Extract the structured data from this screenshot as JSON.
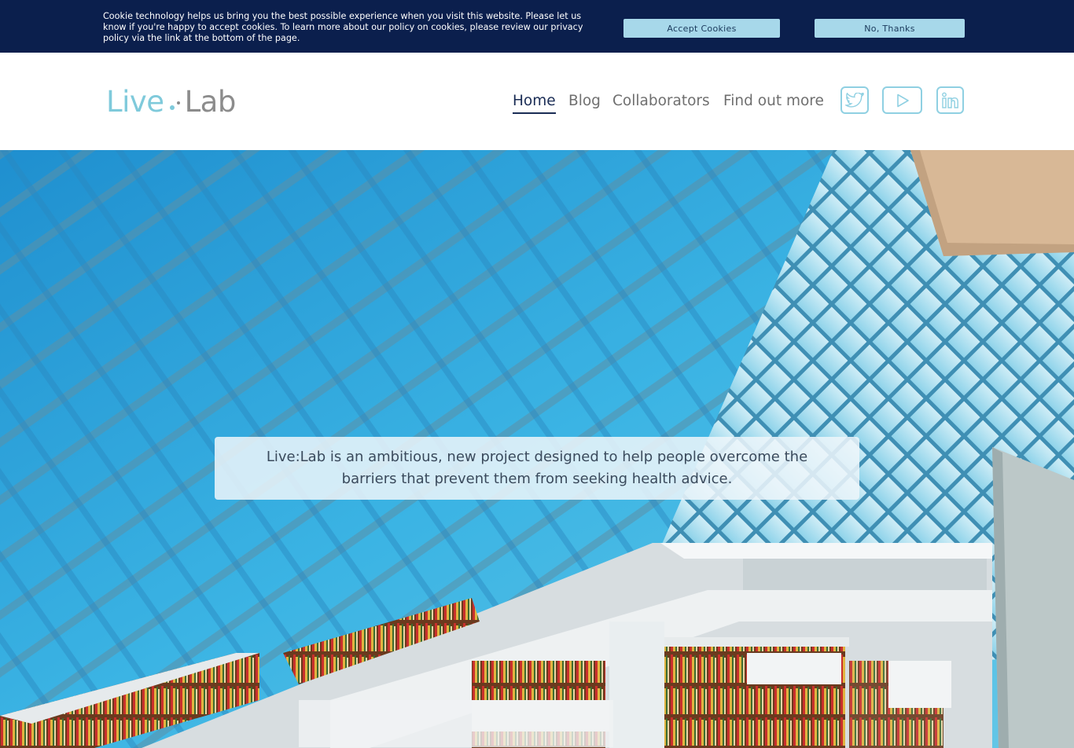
{
  "cookie_banner": {
    "message": "Cookie technology helps us bring you the best possible experience when you visit this website. Please let us know if you're happy to accept cookies. To learn more about our policy on cookies, please review our privacy policy via the link at the bottom of the page.",
    "accept_label": "Accept Cookies",
    "decline_label": "No, Thanks"
  },
  "header": {
    "logo": {
      "word1": "Live",
      "word2": "Lab"
    },
    "nav": [
      {
        "label": "Home",
        "active": true
      },
      {
        "label": "Blog",
        "active": false
      },
      {
        "label": "Collaborators",
        "active": false
      },
      {
        "label": "Find out more",
        "active": false
      }
    ],
    "social": [
      {
        "icon": "twitter-icon"
      },
      {
        "icon": "youtube-icon"
      },
      {
        "icon": "linkedin-icon"
      }
    ]
  },
  "hero": {
    "image": "library-interior-photo",
    "caption": "Live:Lab is an ambitious, new project designed to help people overcome the barriers that prevent them from seeking health advice."
  },
  "colors": {
    "banner_bg": "#0b1f4d",
    "button_bg": "#a7d8ea",
    "logo_accent": "#7fcadb",
    "nav_active": "#1a2c55",
    "nav_text": "#6f6f6f"
  }
}
